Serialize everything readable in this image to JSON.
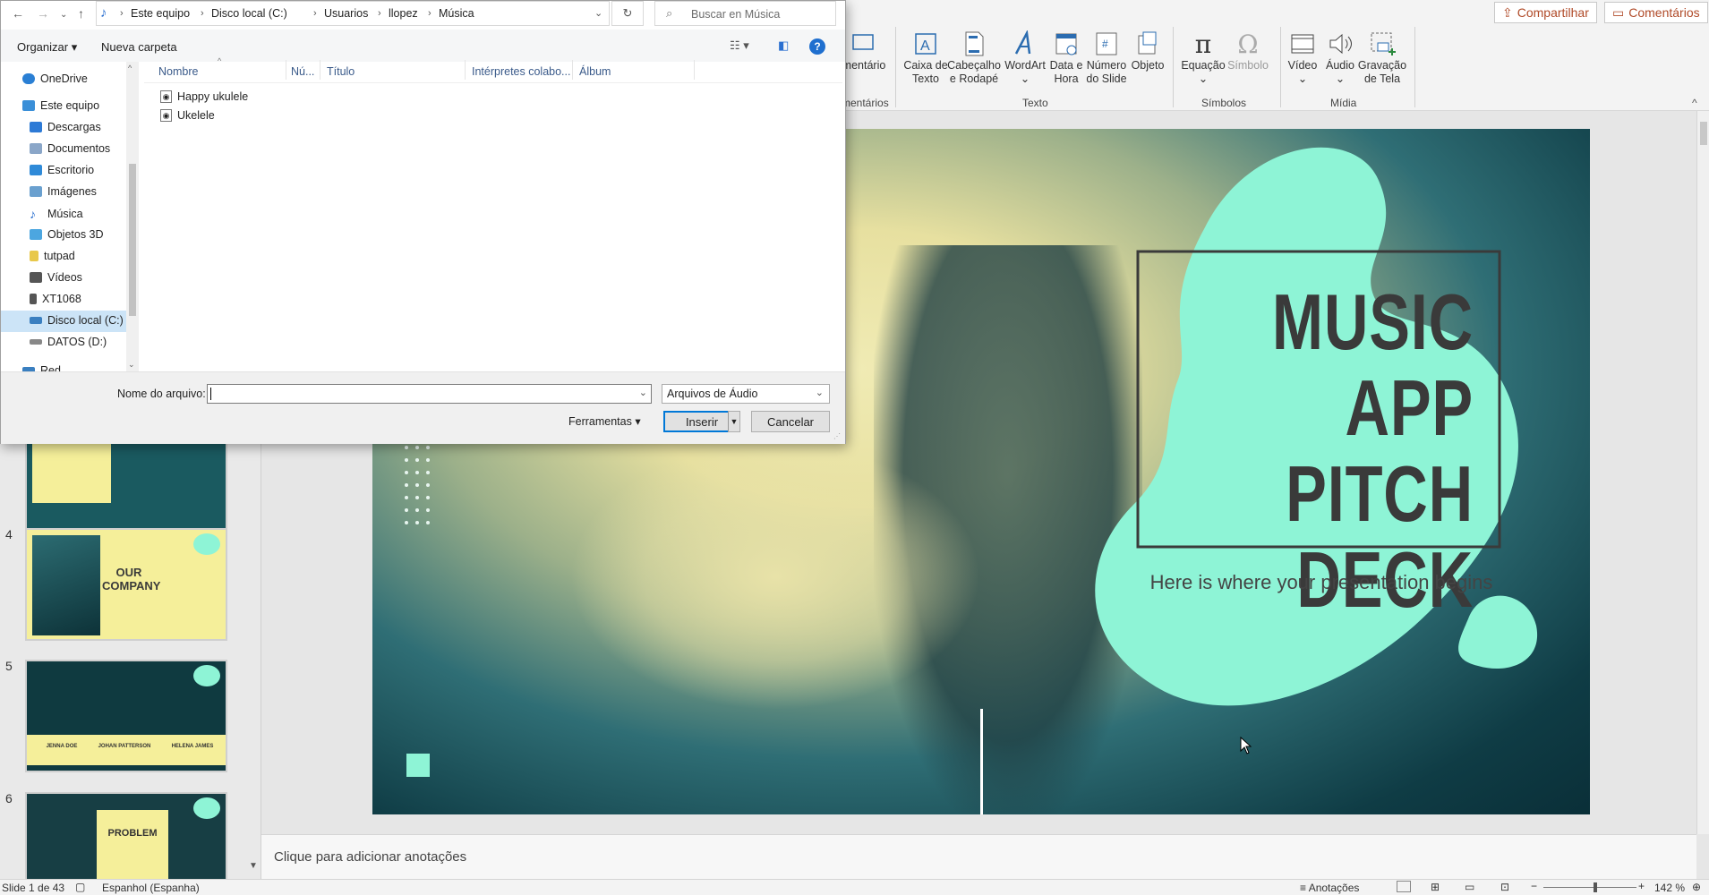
{
  "ribbon": {
    "share": "Compartilhar",
    "comments": "Comentários",
    "partial_button": "mentário",
    "partial_group": "mentários",
    "buttons": [
      {
        "label": "Caixa de Texto",
        "icon": "textbox-icon"
      },
      {
        "label": "Cabeçalho e Rodapé",
        "icon": "header-footer-icon"
      },
      {
        "label": "WordArt",
        "icon": "wordart-icon"
      },
      {
        "label": "Data e Hora",
        "icon": "date-time-icon"
      },
      {
        "label": "Número do Slide",
        "icon": "slide-number-icon"
      },
      {
        "label": "Objeto",
        "icon": "object-icon"
      },
      {
        "label": "Equação",
        "icon": "equation-icon"
      },
      {
        "label": "Símbolo",
        "icon": "omega-icon"
      },
      {
        "label": "Vídeo",
        "icon": "video-icon"
      },
      {
        "label": "Áudio",
        "icon": "audio-icon"
      },
      {
        "label": "Gravação de Tela",
        "icon": "screen-recording-icon"
      }
    ],
    "groups": {
      "texto": "Texto",
      "simbolos": "Símbolos",
      "midia": "Mídia"
    }
  },
  "dialog": {
    "breadcrumb": [
      "Este equipo",
      "Disco local (C:)",
      "Usuarios",
      "llopez",
      "Música"
    ],
    "search_placeholder": "Buscar en Música",
    "organize": "Organizar",
    "new_folder": "Nueva carpeta",
    "columns": [
      "Nombre",
      "Nú...",
      "Título",
      "Intérpretes colabo...",
      "Álbum"
    ],
    "tree": [
      {
        "label": "OneDrive",
        "icon": "cloud-icon",
        "color": "#2a7fd4"
      },
      {
        "label": "Este equipo",
        "icon": "computer-icon",
        "color": "#3a8fd8"
      },
      {
        "label": "Descargas",
        "icon": "download-icon",
        "color": "#2d7ad6"
      },
      {
        "label": "Documentos",
        "icon": "document-icon",
        "color": "#8aa6c8"
      },
      {
        "label": "Escritorio",
        "icon": "desktop-icon",
        "color": "#2f8ad8"
      },
      {
        "label": "Imágenes",
        "icon": "pictures-icon",
        "color": "#6aa0cf"
      },
      {
        "label": "Música",
        "icon": "music-note-icon",
        "color": "#2a6fd0"
      },
      {
        "label": "Objetos 3D",
        "icon": "cube-icon",
        "color": "#4ca6e0"
      },
      {
        "label": "tutpad",
        "icon": "usb-icon",
        "color": "#e8c84a"
      },
      {
        "label": "Vídeos",
        "icon": "film-icon",
        "color": "#555555"
      },
      {
        "label": "XT1068",
        "icon": "phone-icon",
        "color": "#555555"
      },
      {
        "label": "Disco local (C:)",
        "icon": "drive-icon",
        "color": "#3a7fc0"
      },
      {
        "label": "DATOS (D:)",
        "icon": "drive-icon",
        "color": "#888888"
      },
      {
        "label": "Red",
        "icon": "network-icon",
        "color": "#3a7fc0"
      }
    ],
    "files": [
      "Happy ukulele",
      "Ukelele"
    ],
    "filename_label": "Nome do arquivo:",
    "filename_value": "",
    "filetype": "Arquivos de Áudio",
    "tools": "Ferramentas",
    "insert": "Inserir",
    "cancel": "Cancelar"
  },
  "thumbs": {
    "numbers": [
      "4",
      "5",
      "6"
    ],
    "slide4_title": [
      "OUR",
      "COMPANY"
    ],
    "slide6_title": "PROBLEM",
    "slide5_names": [
      "JENNA DOE",
      "JOHAN PATTERSON",
      "HELENA JAMES"
    ]
  },
  "slide": {
    "title_lines": [
      "MUSIC",
      "APP PITCH",
      "DECK"
    ],
    "subtitle": "Here is where your presentation begins",
    "blob_color": "#8ef4d6",
    "title_color": "#3a3a3a"
  },
  "notes_placeholder": "Clique para adicionar anotações",
  "status": {
    "slide": "Slide 1 de 43",
    "language": "Espanhol (Espanha)",
    "notes": "Anotações",
    "zoom": "142 %"
  }
}
